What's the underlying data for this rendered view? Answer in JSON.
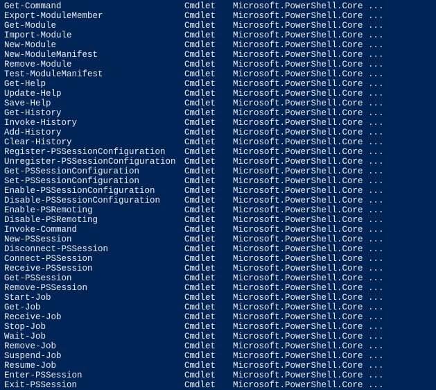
{
  "rows": [
    {
      "name": "Get-Command",
      "type": "Cmdlet",
      "source": "Microsoft.PowerShell.Core ..."
    },
    {
      "name": "Export-ModuleMember",
      "type": "Cmdlet",
      "source": "Microsoft.PowerShell.Core ..."
    },
    {
      "name": "Get-Module",
      "type": "Cmdlet",
      "source": "Microsoft.PowerShell.Core ..."
    },
    {
      "name": "Import-Module",
      "type": "Cmdlet",
      "source": "Microsoft.PowerShell.Core ..."
    },
    {
      "name": "New-Module",
      "type": "Cmdlet",
      "source": "Microsoft.PowerShell.Core ..."
    },
    {
      "name": "New-ModuleManifest",
      "type": "Cmdlet",
      "source": "Microsoft.PowerShell.Core ..."
    },
    {
      "name": "Remove-Module",
      "type": "Cmdlet",
      "source": "Microsoft.PowerShell.Core ..."
    },
    {
      "name": "Test-ModuleManifest",
      "type": "Cmdlet",
      "source": "Microsoft.PowerShell.Core ..."
    },
    {
      "name": "Get-Help",
      "type": "Cmdlet",
      "source": "Microsoft.PowerShell.Core ..."
    },
    {
      "name": "Update-Help",
      "type": "Cmdlet",
      "source": "Microsoft.PowerShell.Core ..."
    },
    {
      "name": "Save-Help",
      "type": "Cmdlet",
      "source": "Microsoft.PowerShell.Core ..."
    },
    {
      "name": "Get-History",
      "type": "Cmdlet",
      "source": "Microsoft.PowerShell.Core ..."
    },
    {
      "name": "Invoke-History",
      "type": "Cmdlet",
      "source": "Microsoft.PowerShell.Core ..."
    },
    {
      "name": "Add-History",
      "type": "Cmdlet",
      "source": "Microsoft.PowerShell.Core ..."
    },
    {
      "name": "Clear-History",
      "type": "Cmdlet",
      "source": "Microsoft.PowerShell.Core ..."
    },
    {
      "name": "Register-PSSessionConfiguration",
      "type": "Cmdlet",
      "source": "Microsoft.PowerShell.Core ..."
    },
    {
      "name": "Unregister-PSSessionConfiguration",
      "type": "Cmdlet",
      "source": "Microsoft.PowerShell.Core ..."
    },
    {
      "name": "Get-PSSessionConfiguration",
      "type": "Cmdlet",
      "source": "Microsoft.PowerShell.Core ..."
    },
    {
      "name": "Set-PSSessionConfiguration",
      "type": "Cmdlet",
      "source": "Microsoft.PowerShell.Core ..."
    },
    {
      "name": "Enable-PSSessionConfiguration",
      "type": "Cmdlet",
      "source": "Microsoft.PowerShell.Core ..."
    },
    {
      "name": "Disable-PSSessionConfiguration",
      "type": "Cmdlet",
      "source": "Microsoft.PowerShell.Core ..."
    },
    {
      "name": "Enable-PSRemoting",
      "type": "Cmdlet",
      "source": "Microsoft.PowerShell.Core ..."
    },
    {
      "name": "Disable-PSRemoting",
      "type": "Cmdlet",
      "source": "Microsoft.PowerShell.Core ..."
    },
    {
      "name": "Invoke-Command",
      "type": "Cmdlet",
      "source": "Microsoft.PowerShell.Core ..."
    },
    {
      "name": "New-PSSession",
      "type": "Cmdlet",
      "source": "Microsoft.PowerShell.Core ..."
    },
    {
      "name": "Disconnect-PSSession",
      "type": "Cmdlet",
      "source": "Microsoft.PowerShell.Core ..."
    },
    {
      "name": "Connect-PSSession",
      "type": "Cmdlet",
      "source": "Microsoft.PowerShell.Core ..."
    },
    {
      "name": "Receive-PSSession",
      "type": "Cmdlet",
      "source": "Microsoft.PowerShell.Core ..."
    },
    {
      "name": "Get-PSSession",
      "type": "Cmdlet",
      "source": "Microsoft.PowerShell.Core ..."
    },
    {
      "name": "Remove-PSSession",
      "type": "Cmdlet",
      "source": "Microsoft.PowerShell.Core ..."
    },
    {
      "name": "Start-Job",
      "type": "Cmdlet",
      "source": "Microsoft.PowerShell.Core ..."
    },
    {
      "name": "Get-Job",
      "type": "Cmdlet",
      "source": "Microsoft.PowerShell.Core ..."
    },
    {
      "name": "Receive-Job",
      "type": "Cmdlet",
      "source": "Microsoft.PowerShell.Core ..."
    },
    {
      "name": "Stop-Job",
      "type": "Cmdlet",
      "source": "Microsoft.PowerShell.Core ..."
    },
    {
      "name": "Wait-Job",
      "type": "Cmdlet",
      "source": "Microsoft.PowerShell.Core ..."
    },
    {
      "name": "Remove-Job",
      "type": "Cmdlet",
      "source": "Microsoft.PowerShell.Core ..."
    },
    {
      "name": "Suspend-Job",
      "type": "Cmdlet",
      "source": "Microsoft.PowerShell.Core ..."
    },
    {
      "name": "Resume-Job",
      "type": "Cmdlet",
      "source": "Microsoft.PowerShell.Core ..."
    },
    {
      "name": "Enter-PSSession",
      "type": "Cmdlet",
      "source": "Microsoft.PowerShell.Core ..."
    },
    {
      "name": "Exit-PSSession",
      "type": "Cmdlet",
      "source": "Microsoft.PowerShell.Core ..."
    }
  ]
}
